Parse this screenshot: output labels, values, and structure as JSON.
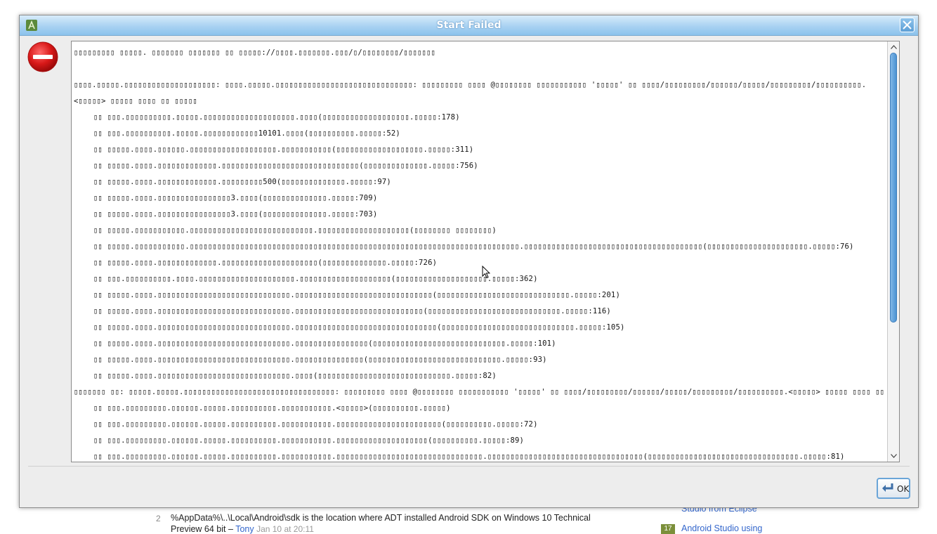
{
  "dialog": {
    "title": "Start Failed",
    "ok_label": "OK",
    "trace_lines": [
      {
        "text": "▯▯▯▯▯▯▯▯▯ ▯▯▯▯▯. ▯▯▯▯▯▯▯ ▯▯▯▯▯▯▯ ▯▯ ▯▯▯▯▯://▯▯▯▯.▯▯▯▯▯▯▯.▯▯▯/▯/▯▯▯▯▯▯▯▯/▯▯▯▯▯▯▯",
        "indent": false
      },
      {
        "text": "",
        "indent": false
      },
      {
        "text": "▯▯▯▯.▯▯▯▯▯.▯▯▯▯▯▯▯▯▯▯▯▯▯▯▯▯▯▯▯▯: ▯▯▯▯.▯▯▯▯▯.▯▯▯▯▯▯▯▯▯▯▯▯▯▯▯▯▯▯▯▯▯▯▯▯▯▯▯▯▯▯: ▯▯▯▯▯▯▯▯▯ ▯▯▯▯ @▯▯▯▯▯▯▯▯ ▯▯▯▯▯▯▯▯▯▯▯ '▯▯▯▯▯' ▯▯ ▯▯▯▯/▯▯▯▯▯▯▯▯▯/▯▯▯▯▯▯/▯▯▯▯▯/▯▯▯▯▯▯▯▯▯/▯▯▯▯▯▯▯▯▯▯.<▯▯▯▯▯> ▯▯▯▯▯ ▯▯▯▯ ▯▯ ▯▯▯▯▯",
        "indent": false,
        "wrap": true
      },
      {
        "text": "▯▯ ▯▯▯.▯▯▯▯▯▯▯▯▯▯.▯▯▯▯▯.▯▯▯▯▯▯▯▯▯▯▯▯▯▯▯▯▯▯▯▯.▯▯▯▯(▯▯▯▯▯▯▯▯▯▯▯▯▯▯▯▯▯▯▯.▯▯▯▯▯:178)",
        "indent": true
      },
      {
        "text": "▯▯ ▯▯▯.▯▯▯▯▯▯▯▯▯▯.▯▯▯▯▯.▯▯▯▯▯▯▯▯▯▯▯▯10101.▯▯▯▯(▯▯▯▯▯▯▯▯▯▯.▯▯▯▯▯:52)",
        "indent": true
      },
      {
        "text": "▯▯ ▯▯▯▯▯.▯▯▯▯.▯▯▯▯▯▯.▯▯▯▯▯▯▯▯▯▯▯▯▯▯▯▯▯▯▯.▯▯▯▯▯▯▯▯▯▯▯(▯▯▯▯▯▯▯▯▯▯▯▯▯▯▯▯▯▯▯.▯▯▯▯▯:311)",
        "indent": true
      },
      {
        "text": "▯▯ ▯▯▯▯▯.▯▯▯▯.▯▯▯▯▯▯▯▯▯▯▯▯▯.▯▯▯▯▯▯▯▯▯▯▯▯▯▯▯▯▯▯▯▯▯▯▯▯▯▯▯▯▯▯(▯▯▯▯▯▯▯▯▯▯▯▯▯▯.▯▯▯▯▯:756)",
        "indent": true
      },
      {
        "text": "▯▯ ▯▯▯▯▯.▯▯▯▯.▯▯▯▯▯▯▯▯▯▯▯▯▯.▯▯▯▯▯▯▯▯▯500(▯▯▯▯▯▯▯▯▯▯▯▯▯▯.▯▯▯▯▯:97)",
        "indent": true
      },
      {
        "text": "▯▯ ▯▯▯▯▯.▯▯▯▯.▯▯▯▯▯▯▯▯▯▯▯▯▯▯▯▯3.▯▯▯▯(▯▯▯▯▯▯▯▯▯▯▯▯▯▯.▯▯▯▯▯:709)",
        "indent": true
      },
      {
        "text": "▯▯ ▯▯▯▯▯.▯▯▯▯.▯▯▯▯▯▯▯▯▯▯▯▯▯▯▯▯3.▯▯▯▯(▯▯▯▯▯▯▯▯▯▯▯▯▯▯.▯▯▯▯▯:703)",
        "indent": true
      },
      {
        "text": "▯▯ ▯▯▯▯▯.▯▯▯▯▯▯▯▯▯▯▯.▯▯▯▯▯▯▯▯▯▯▯▯▯▯▯▯▯▯▯▯▯▯▯▯▯▯▯.▯▯▯▯▯▯▯▯▯▯▯▯▯▯▯▯▯▯▯▯(▯▯▯▯▯▯▯▯ ▯▯▯▯▯▯▯▯)",
        "indent": true
      },
      {
        "text": "▯▯ ▯▯▯▯▯.▯▯▯▯▯▯▯▯▯▯▯.▯▯▯▯▯▯▯▯▯▯▯▯▯▯▯▯▯▯▯▯▯▯▯▯▯▯▯▯▯▯▯▯▯▯▯▯▯▯▯▯▯▯▯▯▯▯▯▯▯▯▯▯▯▯▯▯▯▯▯▯▯▯▯▯▯▯▯▯▯▯▯▯.▯▯▯▯▯▯▯▯▯▯▯▯▯▯▯▯▯▯▯▯▯▯▯▯▯▯▯▯▯▯▯▯▯▯▯▯▯▯▯(▯▯▯▯▯▯▯▯▯▯▯▯▯▯▯▯▯▯▯▯▯▯.▯▯▯▯▯:76)",
        "indent": true
      },
      {
        "text": "▯▯ ▯▯▯▯▯.▯▯▯▯.▯▯▯▯▯▯▯▯▯▯▯▯▯.▯▯▯▯▯▯▯▯▯▯▯▯▯▯▯▯▯▯▯▯▯(▯▯▯▯▯▯▯▯▯▯▯▯▯▯.▯▯▯▯▯:726)",
        "indent": true
      },
      {
        "text": "▯▯ ▯▯▯.▯▯▯▯▯▯▯▯▯▯.▯▯▯▯.▯▯▯▯▯▯▯▯▯▯▯▯▯▯▯▯▯▯▯▯▯.▯▯▯▯▯▯▯▯▯▯▯▯▯▯▯▯▯▯▯▯(▯▯▯▯▯▯▯▯▯▯▯▯▯▯▯▯▯▯▯▯.▯▯▯▯▯:362)",
        "indent": true
      },
      {
        "text": "▯▯ ▯▯▯▯▯.▯▯▯▯.▯▯▯▯▯▯▯▯▯▯▯▯▯▯▯▯▯▯▯▯▯▯▯▯▯▯▯▯▯.▯▯▯▯▯▯▯▯▯▯▯▯▯▯▯▯▯▯▯▯▯▯▯▯▯▯▯▯▯▯(▯▯▯▯▯▯▯▯▯▯▯▯▯▯▯▯▯▯▯▯▯▯▯▯▯▯▯▯▯.▯▯▯▯▯:201)",
        "indent": true
      },
      {
        "text": "▯▯ ▯▯▯▯▯.▯▯▯▯.▯▯▯▯▯▯▯▯▯▯▯▯▯▯▯▯▯▯▯▯▯▯▯▯▯▯▯▯▯.▯▯▯▯▯▯▯▯▯▯▯▯▯▯▯▯▯▯▯▯▯▯▯▯▯▯▯▯(▯▯▯▯▯▯▯▯▯▯▯▯▯▯▯▯▯▯▯▯▯▯▯▯▯▯▯▯▯.▯▯▯▯▯:116)",
        "indent": true
      },
      {
        "text": "▯▯ ▯▯▯▯▯.▯▯▯▯.▯▯▯▯▯▯▯▯▯▯▯▯▯▯▯▯▯▯▯▯▯▯▯▯▯▯▯▯▯.▯▯▯▯▯▯▯▯▯▯▯▯▯▯▯▯▯▯▯▯▯▯▯▯▯▯▯▯▯▯▯(▯▯▯▯▯▯▯▯▯▯▯▯▯▯▯▯▯▯▯▯▯▯▯▯▯▯▯▯▯.▯▯▯▯▯:105)",
        "indent": true
      },
      {
        "text": "▯▯ ▯▯▯▯▯.▯▯▯▯.▯▯▯▯▯▯▯▯▯▯▯▯▯▯▯▯▯▯▯▯▯▯▯▯▯▯▯▯▯.▯▯▯▯▯▯▯▯▯▯▯▯▯▯▯▯(▯▯▯▯▯▯▯▯▯▯▯▯▯▯▯▯▯▯▯▯▯▯▯▯▯▯▯▯▯.▯▯▯▯▯:101)",
        "indent": true
      },
      {
        "text": "▯▯ ▯▯▯▯▯.▯▯▯▯.▯▯▯▯▯▯▯▯▯▯▯▯▯▯▯▯▯▯▯▯▯▯▯▯▯▯▯▯▯.▯▯▯▯▯▯▯▯▯▯▯▯▯▯▯(▯▯▯▯▯▯▯▯▯▯▯▯▯▯▯▯▯▯▯▯▯▯▯▯▯▯▯▯▯.▯▯▯▯▯:93)",
        "indent": true
      },
      {
        "text": "▯▯ ▯▯▯▯▯.▯▯▯▯.▯▯▯▯▯▯▯▯▯▯▯▯▯▯▯▯▯▯▯▯▯▯▯▯▯▯▯▯▯.▯▯▯▯(▯▯▯▯▯▯▯▯▯▯▯▯▯▯▯▯▯▯▯▯▯▯▯▯▯▯▯▯▯.▯▯▯▯▯:82)",
        "indent": true
      },
      {
        "text": "▯▯▯▯▯▯▯ ▯▯: ▯▯▯▯▯.▯▯▯▯▯.▯▯▯▯▯▯▯▯▯▯▯▯▯▯▯▯▯▯▯▯▯▯▯▯▯▯▯▯▯▯▯▯▯: ▯▯▯▯▯▯▯▯▯ ▯▯▯▯ @▯▯▯▯▯▯▯▯ ▯▯▯▯▯▯▯▯▯▯▯ '▯▯▯▯▯' ▯▯ ▯▯▯▯/▯▯▯▯▯▯▯▯▯/▯▯▯▯▯▯/▯▯▯▯▯/▯▯▯▯▯▯▯▯▯/▯▯▯▯▯▯▯▯▯▯.<▯▯▯▯▯> ▯▯▯▯▯ ▯▯▯▯ ▯▯ ▯▯▯▯▯",
        "indent": false
      },
      {
        "text": "▯▯ ▯▯▯.▯▯▯▯▯▯▯▯▯.▯▯▯▯▯▯.▯▯▯▯▯.▯▯▯▯▯▯▯▯▯▯.▯▯▯▯▯▯▯▯▯▯▯.<▯▯▯▯▯>(▯▯▯▯▯▯▯▯▯▯.▯▯▯▯▯)",
        "indent": true
      },
      {
        "text": "▯▯ ▯▯▯.▯▯▯▯▯▯▯▯▯.▯▯▯▯▯▯.▯▯▯▯▯.▯▯▯▯▯▯▯▯▯▯.▯▯▯▯▯▯▯▯▯▯▯.▯▯▯▯▯▯▯▯▯▯▯▯▯▯▯▯▯▯▯▯▯▯▯(▯▯▯▯▯▯▯▯▯▯.▯▯▯▯▯:72)",
        "indent": true
      },
      {
        "text": "▯▯ ▯▯▯.▯▯▯▯▯▯▯▯▯.▯▯▯▯▯▯.▯▯▯▯▯.▯▯▯▯▯▯▯▯▯▯.▯▯▯▯▯▯▯▯▯▯▯.▯▯▯▯▯▯▯▯▯▯▯▯▯▯▯▯▯▯▯▯(▯▯▯▯▯▯▯▯▯▯.▯▯▯▯▯:89)",
        "indent": true
      },
      {
        "text": "▯▯ ▯▯▯.▯▯▯▯▯▯▯▯▯.▯▯▯▯▯▯.▯▯▯▯▯.▯▯▯▯▯▯▯▯▯▯.▯▯▯▯▯▯▯▯▯▯▯.▯▯▯▯▯▯▯▯▯▯▯▯▯▯▯▯▯▯▯▯▯▯▯▯▯▯▯▯▯▯▯▯.▯▯▯▯▯▯▯▯▯▯▯▯▯▯▯▯▯▯▯▯▯▯▯▯▯▯▯▯▯▯▯▯▯▯(▯▯▯▯▯▯▯▯▯▯▯▯▯▯▯▯▯▯▯▯▯▯▯▯▯▯▯▯▯▯▯▯▯.▯▯▯▯▯:81)",
        "indent": true
      }
    ]
  },
  "background": {
    "comment_number": "2",
    "comment_text_line1": "%AppData%\\..\\Local\\Android\\sdk is the location where ADT installed Android SDK on Windows 10 Technical",
    "comment_text_line2_prefix": "Preview 64 bit – ",
    "comment_author": "Tony",
    "comment_date": "Jan 10 at 20:11",
    "side_link_1": "Studio from Eclipse",
    "side_badge": "17",
    "side_link_2": "Android Studio using"
  }
}
